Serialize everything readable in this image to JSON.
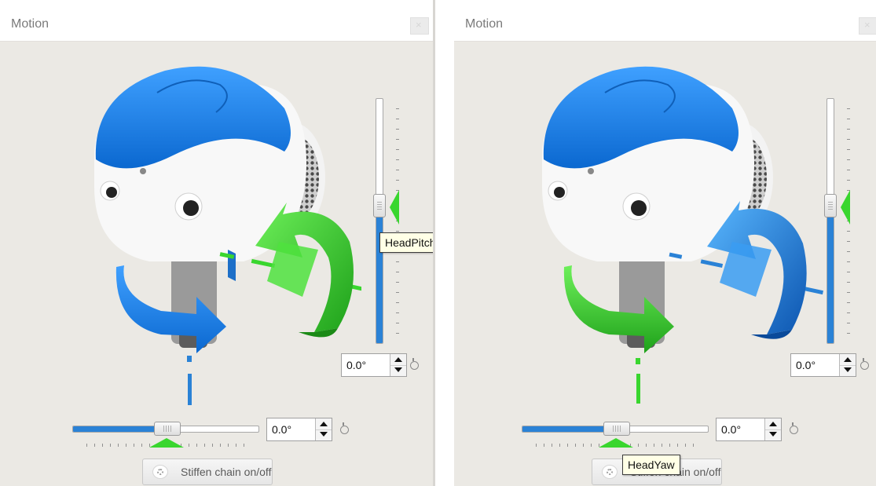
{
  "panels": [
    {
      "title": "Motion",
      "pitch": {
        "value": "0.0°",
        "level": 0.5,
        "tooltip": "HeadPitch"
      },
      "yaw": {
        "value": "0.0°",
        "level": 0.5
      },
      "stiffen_label": "Stiffen chain on/off",
      "highlighted_joint": "pitch"
    },
    {
      "title": "Motion",
      "pitch": {
        "value": "0.0°",
        "level": 0.5
      },
      "yaw": {
        "value": "0.0°",
        "level": 0.5,
        "tooltip": "HeadYaw"
      },
      "stiffen_label": "Stiffen chain on/off",
      "highlighted_joint": "yaw"
    }
  ],
  "colors": {
    "accent_blue": "#2a82d6",
    "highlight_green": "#39d62e",
    "robot_blue": "#1f86e8",
    "panel_bg": "#ebe9e4"
  },
  "icons": [
    "close-icon",
    "spin-up-icon",
    "spin-down-icon",
    "reset-icon",
    "stiffen-icon"
  ]
}
